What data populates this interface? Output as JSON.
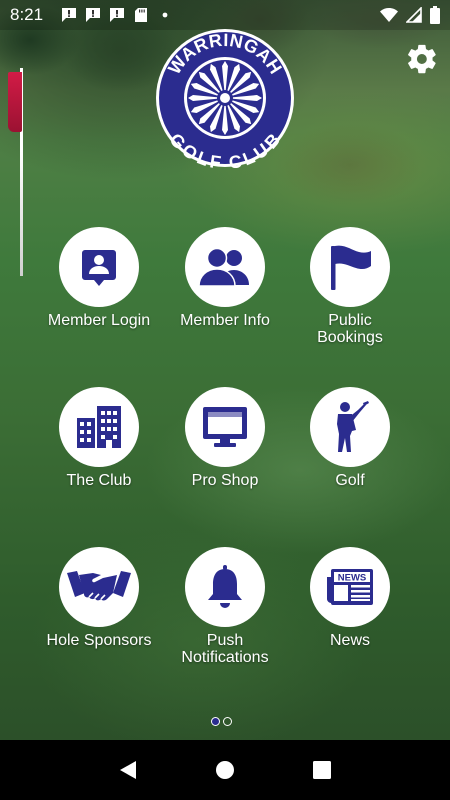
{
  "status_bar": {
    "time": "8:21",
    "notification_icons": [
      "message-alert-icon",
      "message-alert-icon",
      "message-alert-icon",
      "sd-card-icon",
      "dot-icon"
    ],
    "right_icons": [
      "wifi-icon",
      "signal-icon",
      "battery-icon"
    ]
  },
  "logo": {
    "top_text": "WARRINGAH",
    "bottom_text": "GOLF CLUB",
    "color": "#2b2c8f"
  },
  "settings": {
    "icon": "gear-icon"
  },
  "theme": {
    "accent": "#2b2c8f",
    "tile_bg": "#ffffff",
    "flag": "#c2143b"
  },
  "tiles": [
    {
      "label": "Member Login",
      "icon": "member-login-icon"
    },
    {
      "label": "Member Info",
      "icon": "members-group-icon"
    },
    {
      "label": "Public Bookings",
      "icon": "flag-icon"
    },
    {
      "label": "The Club",
      "icon": "building-icon"
    },
    {
      "label": "Pro Shop",
      "icon": "monitor-icon"
    },
    {
      "label": "Golf",
      "icon": "golfer-icon"
    },
    {
      "label": "Hole Sponsors",
      "icon": "handshake-icon"
    },
    {
      "label": "Push Notifications",
      "icon": "bell-icon"
    },
    {
      "label": "News",
      "icon": "newspaper-icon"
    }
  ],
  "news_icon_text": "NEWS",
  "pager": {
    "pages": 2,
    "current": 1
  },
  "nav_bar": {
    "buttons": [
      "back-icon",
      "home-icon",
      "recents-icon"
    ]
  }
}
